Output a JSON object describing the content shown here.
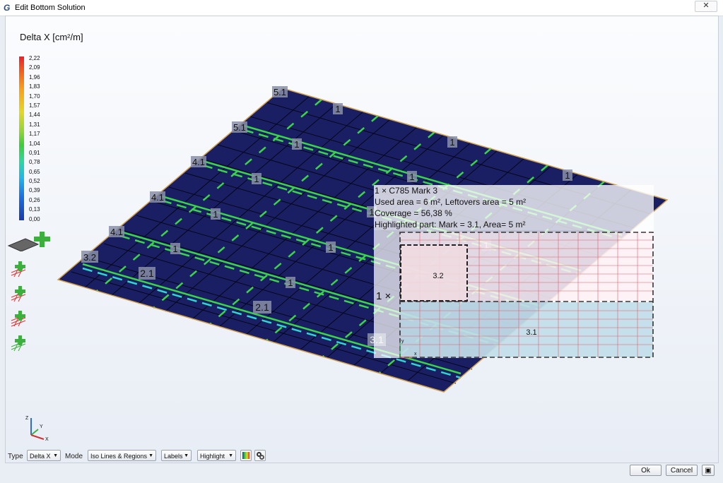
{
  "window": {
    "title": "Edit Bottom Solution",
    "app_icon": "G",
    "close_label": "✕"
  },
  "legend": {
    "title": "Delta X [cm²/m]",
    "values": [
      "2,22",
      "2,09",
      "1,96",
      "1,83",
      "1,70",
      "1,57",
      "1,44",
      "1,31",
      "1,17",
      "1,04",
      "0,91",
      "0,78",
      "0,65",
      "0,52",
      "0,39",
      "0,26",
      "0,13",
      "0,00"
    ]
  },
  "plate_labels": [
    "5.1",
    "1",
    "5.1",
    "1",
    "1",
    "4.1",
    "1",
    "1",
    "1",
    "4.1",
    "1",
    "1",
    "4.1",
    "1",
    "1",
    "3.2",
    "2.1",
    "1",
    "2.1",
    "1",
    "3.1"
  ],
  "info": {
    "line1": "1 × C785 Mark 3",
    "line2": "Used area = 6 m², Leftovers area = 5 m²",
    "line3": "Coverage = 56,38 %",
    "line4": "Highlighted part: Mark = 3.1, Area= 5 m²"
  },
  "sheet": {
    "multiplier": "1 ×",
    "part_a": "3.2",
    "part_b": "3.1",
    "axis_x": "x",
    "axis_y": "y"
  },
  "axis_gizmo": {
    "x": "X",
    "y": "Y",
    "z": "Z"
  },
  "toolbar": {
    "type_label": "Type",
    "type_value": "Delta X",
    "mode_label": "Mode",
    "mode_value": "Iso Lines & Regions",
    "labels_value": "Labels",
    "highlight_value": "Highlight"
  },
  "buttons": {
    "ok": "Ok",
    "cancel": "Cancel"
  },
  "colors": {
    "plate": "#1a1f63",
    "grid": "#000000",
    "bar": "#3ad44a",
    "legend_top": "#e8232a",
    "legend_bottom": "#1a3aa8"
  }
}
